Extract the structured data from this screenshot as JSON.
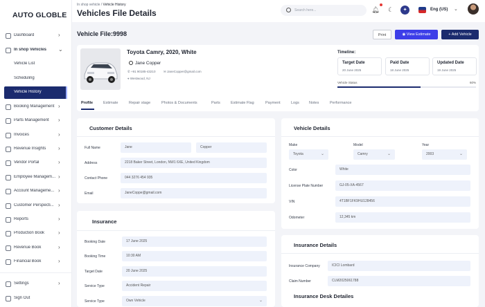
{
  "brand": "AUTO GLOBLE",
  "sidebar": {
    "items": [
      {
        "label": "Dashboard"
      },
      {
        "label": "In shop Vehicles"
      },
      {
        "label": "Vehicle List"
      },
      {
        "label": "Scheduling"
      },
      {
        "label": "Vehicle History"
      },
      {
        "label": "Booking Management"
      },
      {
        "label": "Parts Management"
      },
      {
        "label": "Invoices"
      },
      {
        "label": "Revenue Insights"
      },
      {
        "label": "Vendor Portal"
      },
      {
        "label": "Employee Managem..."
      },
      {
        "label": "Account Manageme..."
      },
      {
        "label": "Customer Perspecti..."
      },
      {
        "label": "Reports"
      },
      {
        "label": "Production Book"
      },
      {
        "label": "Revenue Book"
      },
      {
        "label": "Financial Book"
      },
      {
        "label": "Settings"
      },
      {
        "label": "Sign Out"
      }
    ]
  },
  "header": {
    "crumb_parent": "In shop vehicle /",
    "crumb_current": "Vehicle History",
    "title": "Vehicles File Details",
    "search_placeholder": "Search here...",
    "language": "Eng (US)"
  },
  "file": {
    "title": "Vehicle File:9998",
    "print": "Print",
    "view_estimate": "View Estimate",
    "add_vehicle": "Add Vehicle"
  },
  "vehicle": {
    "name": "Toyota Camry, 2020, White",
    "owner": "Jane Copper",
    "phone": "+91 90185-43210",
    "email": "JaneCopper@gmail.com",
    "location": "Westwood, NJ"
  },
  "timeline": {
    "title": "Timeline:",
    "boxes": [
      {
        "label": "Target Date",
        "value": "20 June 2025"
      },
      {
        "label": "Paid Date",
        "value": "18 June 2025"
      },
      {
        "label": "Updated Date",
        "value": "19 June 2025"
      }
    ],
    "status_label": "Vehicle Status",
    "status_pct": "60%",
    "status_value": 0.6
  },
  "tabs": [
    "Profile",
    "Estimate",
    "Repair stage",
    "Photos & Documents",
    "Parts",
    "Estimate Flag",
    "Payment",
    "Logs",
    "Notes",
    "Performance"
  ],
  "customer": {
    "title": "Customer Details",
    "full_name_label": "Full Name",
    "first": "Jane",
    "last": "Copper",
    "address_label": "Address",
    "address": "2218 Baker Street, London, NW1 6XE, United Kingdom",
    "phone_label": "Contact Phone",
    "phone": "044 3276 454 935",
    "email_label": "Email",
    "email": "JaneCoppe@gmail.com"
  },
  "insurance": {
    "title": "Insurance",
    "rows": [
      {
        "label": "Booking Date",
        "value": "17 June 2025"
      },
      {
        "label": "Booking Time",
        "value": "10:30 AM"
      },
      {
        "label": "Target Date",
        "value": "20 June 2025"
      },
      {
        "label": "Service Type",
        "value": "Accident Repair"
      },
      {
        "label": "Service Type",
        "value": "Own Vehicle"
      }
    ]
  },
  "vdetails": {
    "title": "Vehicle Details",
    "make_label": "Make",
    "make": "Toyota",
    "model_label": "Model",
    "model": "Camry",
    "year_label": "Year",
    "year": "2003",
    "color_label": "Color",
    "color": "White",
    "plate_label": "License Plate Number",
    "plate": "GJ-05-XA-4567",
    "vin_label": "VIN",
    "vin": "4T1BF1FK9HU128456",
    "odo_label": "Odometer",
    "odo": "12,345 km"
  },
  "idetails": {
    "title": "Insurance Details",
    "company_label": "Insurance Company",
    "company": "ICICI Lombard",
    "claim_label": "Claim Number",
    "claim": "CLM2025061788",
    "desk_title": "Insurance Desk Detailes"
  },
  "colors": {
    "navy": "#1b2b6e",
    "accent": "#3d3ee8",
    "field": "#eef2fb"
  }
}
